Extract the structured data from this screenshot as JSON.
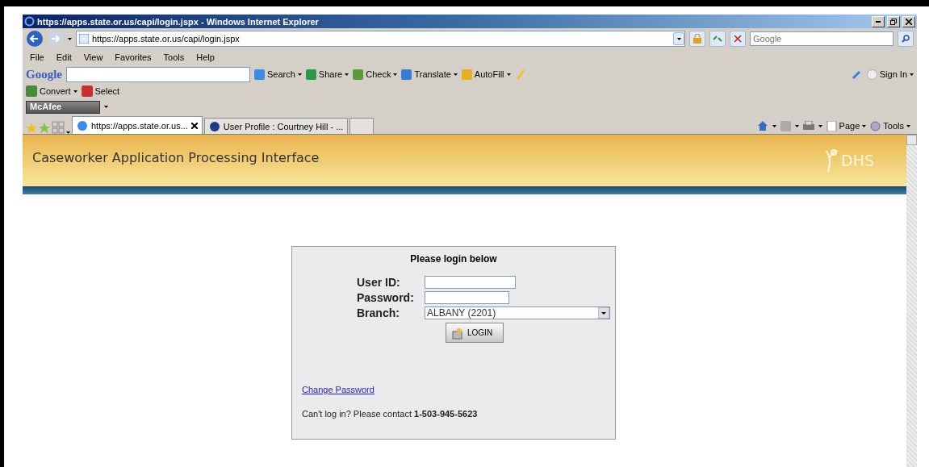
{
  "window": {
    "title": "https://apps.state.or.us/capi/login.jspx - Windows Internet Explorer"
  },
  "address_bar": {
    "url": "https://apps.state.or.us/capi/login.jspx"
  },
  "search_box": {
    "placeholder": "Google"
  },
  "menu": [
    "File",
    "Edit",
    "View",
    "Favorites",
    "Tools",
    "Help"
  ],
  "google_toolbar": {
    "logo": "Google",
    "items": [
      {
        "label": "Search"
      },
      {
        "label": "Share"
      },
      {
        "label": "Check"
      },
      {
        "label": "Translate"
      },
      {
        "label": "AutoFill"
      }
    ],
    "sign_in": "Sign In"
  },
  "links_toolbar": [
    "Convert",
    "Select"
  ],
  "mcafee": "McAfee",
  "tabs": [
    {
      "label": "https://apps.state.or.us...",
      "selected": true
    },
    {
      "label": "User Profile : Courtney Hill - ...",
      "selected": false
    }
  ],
  "command_bar": [
    "Page",
    "Tools"
  ],
  "page": {
    "header_title": "Caseworker Application Processing Interface",
    "logo_text": "DHS",
    "login": {
      "heading": "Please login below",
      "fields": [
        {
          "kind": "text",
          "label": "User ID:"
        },
        {
          "kind": "text",
          "label": "Password:"
        },
        {
          "kind": "select",
          "label": "Branch:",
          "value": "ALBANY (2201)"
        }
      ],
      "button": "LOGIN",
      "change_password": "Change Password",
      "contact": "Can't log in? Please contact **1-503-945-5623**"
    }
  }
}
